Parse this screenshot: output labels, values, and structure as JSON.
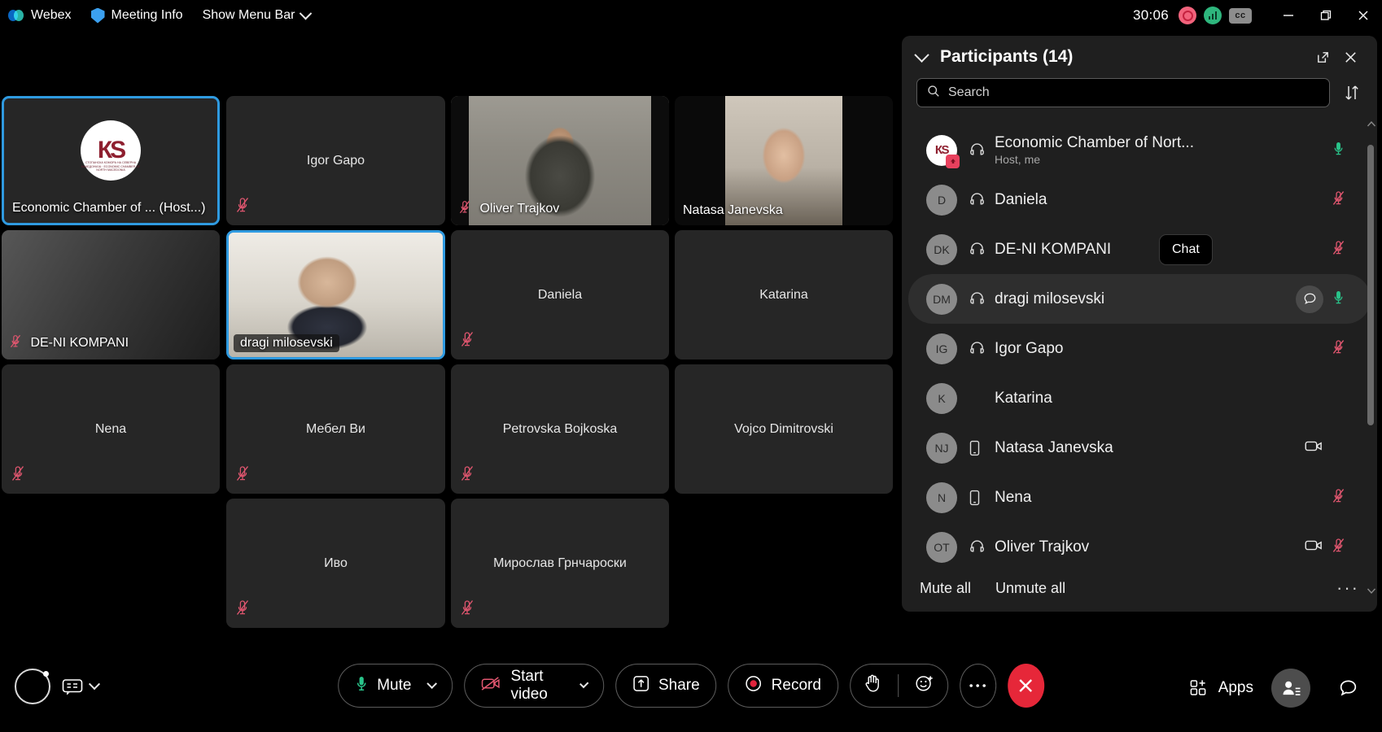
{
  "topbar": {
    "app_name": "Webex",
    "meeting_info": "Meeting Info",
    "show_menu_bar": "Show Menu Bar",
    "timer": "30:06",
    "cc_badge": "cc",
    "icons": {
      "webex": "webex-logo-icon",
      "shield": "shield-icon",
      "chevron": "chevron-down-icon",
      "record_indicator": "recording-indicator-icon",
      "signal": "network-signal-icon",
      "minimize": "minimize-icon",
      "restore": "restore-icon",
      "close": "close-icon"
    }
  },
  "grid": {
    "tiles": [
      {
        "name": "Economic Chamber of ... (Host...)",
        "label_pos": "bottom-left",
        "selected": true,
        "muted": false,
        "has_video": false,
        "avatar": "logo",
        "logo_mark": "КЅ",
        "logo_sub": "СТОПАНСКА КОМОРА НА СЕВЕРНА МАКЕДОНИЈА · ECONOMIC CHAMBER OF NORTH MACEDONIA"
      },
      {
        "name": "Igor Gapo",
        "label_pos": "center",
        "selected": false,
        "muted": true,
        "has_video": false
      },
      {
        "name": "Oliver Trajkov",
        "label_pos": "bottom-left",
        "selected": false,
        "muted": true,
        "has_video": true,
        "video_style": "man-dark-shirt"
      },
      {
        "name": "Natasa Janevska",
        "label_pos": "bottom-left",
        "selected": false,
        "muted": false,
        "has_video": true,
        "video_style": "woman-portrait"
      },
      {
        "name": "DE-NI KOMPANI",
        "label_pos": "bottom-left",
        "selected": false,
        "muted": true,
        "has_video": true,
        "video_style": "dark-gradient"
      },
      {
        "name": "dragi milosevski",
        "label_pos": "bottom-left-plate",
        "selected": true,
        "muted": false,
        "has_video": true,
        "video_style": "older-man"
      },
      {
        "name": "Daniela",
        "label_pos": "center",
        "selected": false,
        "muted": true,
        "has_video": false
      },
      {
        "name": "Katarina",
        "label_pos": "center",
        "selected": false,
        "muted": false,
        "has_video": false
      },
      {
        "name": "Nena",
        "label_pos": "center",
        "selected": false,
        "muted": true,
        "has_video": false
      },
      {
        "name": "Мебел Ви",
        "label_pos": "center",
        "selected": false,
        "muted": true,
        "has_video": false
      },
      {
        "name": "Petrovska Bojkoska",
        "label_pos": "center",
        "selected": false,
        "muted": true,
        "has_video": false
      },
      {
        "name": "Vojco Dimitrovski",
        "label_pos": "center",
        "selected": false,
        "muted": false,
        "has_video": false
      },
      {
        "name": "Иво",
        "label_pos": "center",
        "selected": false,
        "muted": true,
        "has_video": false
      },
      {
        "name": "Мирослав Грнчароски",
        "label_pos": "center",
        "selected": false,
        "muted": true,
        "has_video": false
      }
    ]
  },
  "panel": {
    "title": "Participants (14)",
    "search_placeholder": "Search",
    "tooltip": "Chat",
    "footer": {
      "mute_all": "Mute all",
      "unmute_all": "Unmute all",
      "more": "···"
    },
    "participants": [
      {
        "initials": "",
        "avatar": "logo",
        "name": "Economic Chamber of Nort...",
        "sub": "Host, me",
        "device": "headset",
        "mic": "on",
        "camera": false,
        "hover": false
      },
      {
        "initials": "D",
        "avatar": "text",
        "name": "Daniela",
        "sub": "",
        "device": "headset",
        "mic": "off",
        "camera": false,
        "hover": false
      },
      {
        "initials": "DK",
        "avatar": "text",
        "name": "DE-NI KOMPANI",
        "sub": "",
        "device": "headset",
        "mic": "off",
        "camera": false,
        "hover": false
      },
      {
        "initials": "DM",
        "avatar": "text",
        "name": "dragi milosevski",
        "sub": "",
        "device": "headset",
        "mic": "on",
        "camera": false,
        "hover": true
      },
      {
        "initials": "IG",
        "avatar": "text",
        "name": "Igor Gapo",
        "sub": "",
        "device": "headset",
        "mic": "off",
        "camera": false,
        "hover": false
      },
      {
        "initials": "K",
        "avatar": "text",
        "name": "Katarina",
        "sub": "",
        "device": "none",
        "mic": "none",
        "camera": false,
        "hover": false
      },
      {
        "initials": "NJ",
        "avatar": "text",
        "name": "Natasa Janevska",
        "sub": "",
        "device": "mobile",
        "mic": "none",
        "camera": true,
        "hover": false
      },
      {
        "initials": "N",
        "avatar": "text",
        "name": "Nena",
        "sub": "",
        "device": "mobile",
        "mic": "off",
        "camera": false,
        "hover": false
      },
      {
        "initials": "OT",
        "avatar": "text",
        "name": "Oliver Trajkov",
        "sub": "",
        "device": "headset",
        "mic": "off",
        "camera": true,
        "hover": false
      }
    ]
  },
  "toolbar": {
    "mute": "Mute",
    "start_video": "Start video",
    "share": "Share",
    "record": "Record",
    "apps": "Apps",
    "icons": {
      "audio_circle": "audio-settings-icon",
      "closed_caption": "closed-caption-icon",
      "mic": "microphone-icon",
      "camera_off": "camera-off-icon",
      "share": "share-screen-icon",
      "record": "record-icon",
      "raise_hand": "raise-hand-icon",
      "reactions": "reactions-icon",
      "more": "more-options-icon",
      "end_call": "end-call-icon",
      "apps": "apps-grid-icon",
      "participants": "participants-icon",
      "chat": "chat-icon"
    }
  },
  "colors": {
    "accent": "#2f9ae0",
    "mic_on": "#29c48a",
    "mic_off": "#e0566f",
    "end_call": "#e62739",
    "panel_bg": "#1f1f1f",
    "tile_bg": "#262626"
  }
}
